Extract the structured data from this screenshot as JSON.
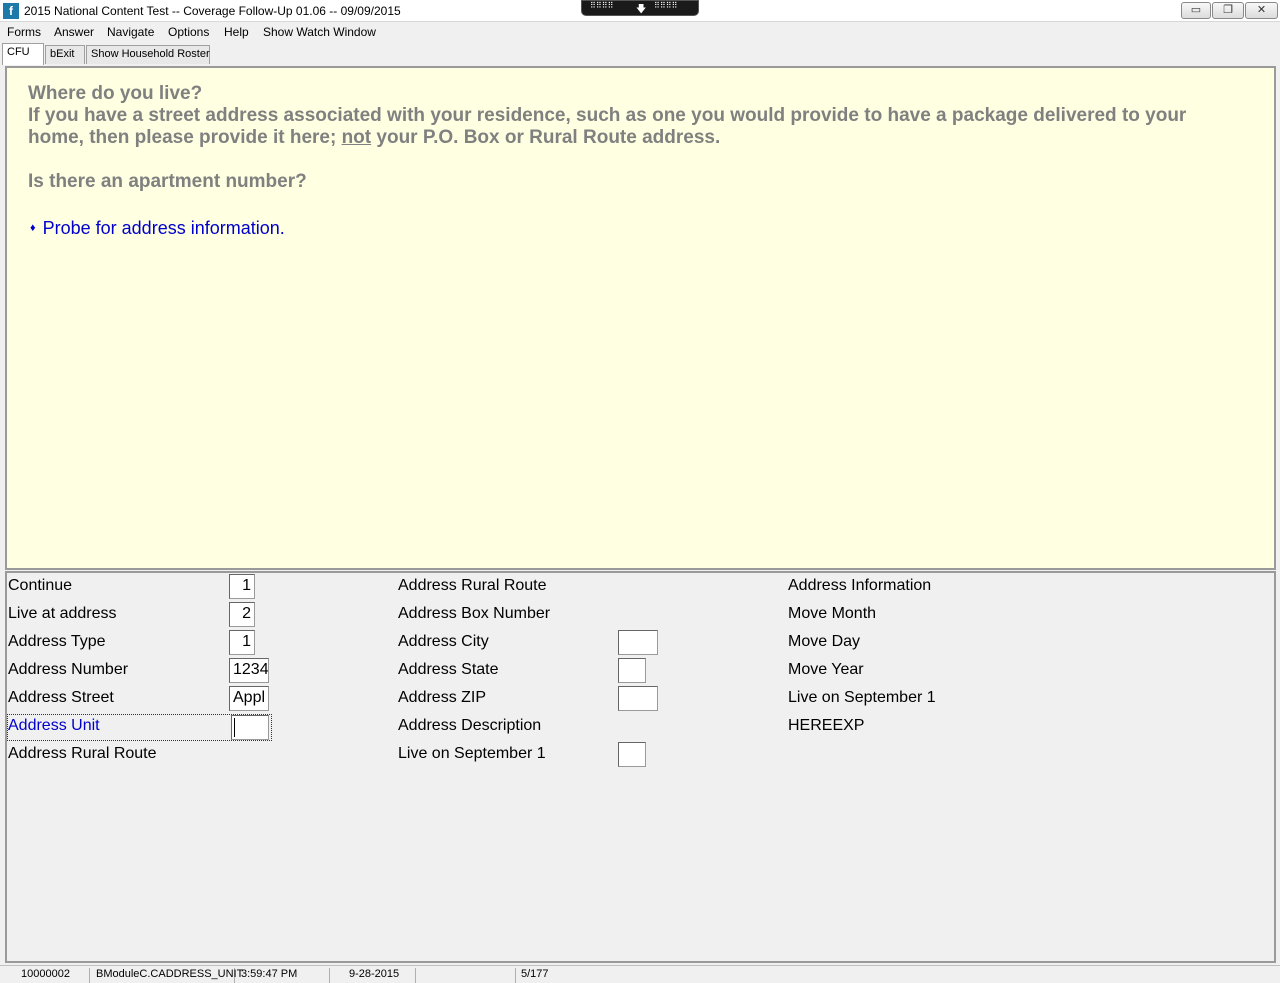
{
  "window": {
    "title": "2015 National Content Test -- Coverage Follow-Up 01.06 -- 09/09/2015",
    "app_icon_glyph": "f",
    "minimize_glyph": "▭",
    "maximize_glyph": "❐",
    "close_glyph": "✕"
  },
  "ribbon": {
    "dots_left": "⠿⠿⠿⠿",
    "arrow": "🡇",
    "dots_right": "⠿⠿⠿⠿"
  },
  "menu": {
    "items": [
      "Forms",
      "Answer",
      "Navigate",
      "Options",
      "Help",
      "Show Watch Window"
    ]
  },
  "tabs": {
    "items": [
      "CFU",
      "bExit",
      "Show Household Roster"
    ],
    "active": "CFU"
  },
  "question": {
    "line1": "Where do you live?",
    "line2": "If you have a street address associated with your residence, such as one you would provide to have a package delivered to your",
    "line3_pre": "home, then please provide it here; ",
    "line3_underlined": "not",
    "line3_post": " your P.O. Box or Rural Route address.",
    "line4": "Is there an apartment number?",
    "probe_bullet": "♦",
    "probe": "Probe for address information."
  },
  "fields": {
    "col1": [
      {
        "label": "Continue",
        "value": "1"
      },
      {
        "label": "Live at address",
        "value": "2"
      },
      {
        "label": "Address Type",
        "value": "1"
      },
      {
        "label": "Address Number",
        "value": "1234"
      },
      {
        "label": "Address Street",
        "value": "Appl"
      },
      {
        "label": "Address Unit",
        "value": ""
      },
      {
        "label": "Address Rural Route",
        "value": ""
      }
    ],
    "col2": [
      {
        "label": "Address Rural Route"
      },
      {
        "label": "Address Box Number"
      },
      {
        "label": "Address City",
        "value": ""
      },
      {
        "label": "Address State",
        "value": ""
      },
      {
        "label": "Address ZIP",
        "value": ""
      },
      {
        "label": "Address Description"
      },
      {
        "label": "Live on September 1",
        "value": ""
      }
    ],
    "col3": [
      {
        "label": "Address Information"
      },
      {
        "label": "Move Month"
      },
      {
        "label": "Move Day"
      },
      {
        "label": "Move Year"
      },
      {
        "label": "Live on September 1"
      },
      {
        "label": "HEREEXP"
      }
    ]
  },
  "status": {
    "case_id": "10000002",
    "field_path": "BModuleC.CADDRESS_UNIT",
    "time": "3:59:47 PM",
    "date": "9-28-2015",
    "blank": "",
    "page": "5/177"
  },
  "colors": {
    "question_bg": "#ffffe1",
    "question_text": "#808080",
    "probe_text": "#0000cc",
    "current_field_label": "#0000cc"
  }
}
